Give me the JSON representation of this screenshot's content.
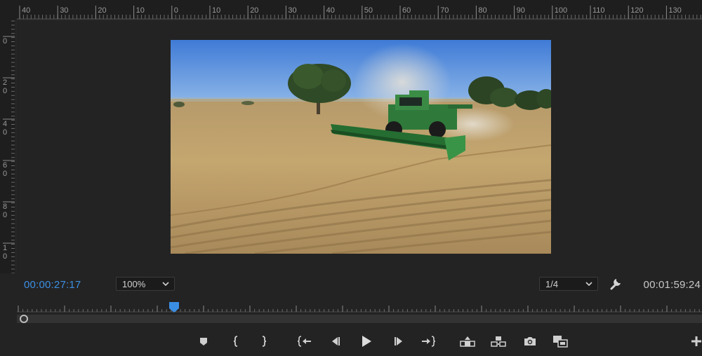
{
  "ruler": {
    "top_labels": [
      "40",
      "30",
      "20",
      "10",
      "0",
      "10",
      "20",
      "30",
      "40",
      "50",
      "60",
      "70",
      "80",
      "90",
      "100",
      "110",
      "120",
      "130"
    ],
    "left_labels": [
      [
        "0"
      ],
      [
        "2",
        "0"
      ],
      [
        "4",
        "0"
      ],
      [
        "6",
        "0"
      ],
      [
        "8",
        "0"
      ],
      [
        "1",
        "0"
      ]
    ]
  },
  "monitor": {
    "current_timecode": "00:00:27:17",
    "duration_timecode": "00:01:59:24",
    "zoom_level": "100%",
    "playback_resolution": "1/4",
    "playhead_progress": 0.23
  },
  "colors": {
    "accent": "#3b8fe3",
    "panel_bg": "#232323",
    "ruler_bg": "#1e1e1e"
  },
  "controls": [
    {
      "name": "add-marker-button",
      "icon": "marker-icon"
    },
    {
      "name": "mark-in-button",
      "icon": "mark-in-icon"
    },
    {
      "name": "mark-out-button",
      "icon": "mark-out-icon"
    },
    {
      "name": "go-to-in-button",
      "icon": "go-to-in-icon"
    },
    {
      "name": "step-back-button",
      "icon": "step-back-icon"
    },
    {
      "name": "play-button",
      "icon": "play-icon"
    },
    {
      "name": "step-forward-button",
      "icon": "step-forward-icon"
    },
    {
      "name": "go-to-out-button",
      "icon": "go-to-out-icon"
    },
    {
      "name": "lift-button",
      "icon": "lift-icon"
    },
    {
      "name": "extract-button",
      "icon": "extract-icon"
    },
    {
      "name": "export-frame-button",
      "icon": "camera-icon"
    },
    {
      "name": "comparison-view-button",
      "icon": "comparison-view-icon"
    },
    {
      "name": "button-editor-button",
      "icon": "plus-icon"
    }
  ]
}
